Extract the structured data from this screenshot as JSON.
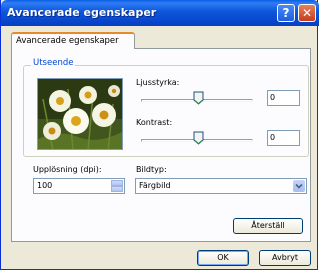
{
  "window": {
    "title": "Avancerade egenskaper",
    "help_glyph": "?",
    "close_glyph": "✕"
  },
  "tabs": [
    {
      "label": "Avancerade egenskaper",
      "selected": true
    }
  ],
  "appearance": {
    "group_label": "Utseende",
    "brightness_label": "Ljusstyrka:",
    "brightness_value": "0",
    "contrast_label": "Kontrast:",
    "contrast_value": "0"
  },
  "resolution": {
    "label": "Upplösning (dpi):",
    "value": "100"
  },
  "image_type": {
    "label": "Bildtyp:",
    "selected": "Färgbild"
  },
  "buttons": {
    "reset": "Återställ",
    "ok": "OK",
    "cancel": "Avbryt"
  },
  "icons": {
    "combo_arrow": "chevron-down-icon",
    "spin": "spin-arrows-icon"
  }
}
